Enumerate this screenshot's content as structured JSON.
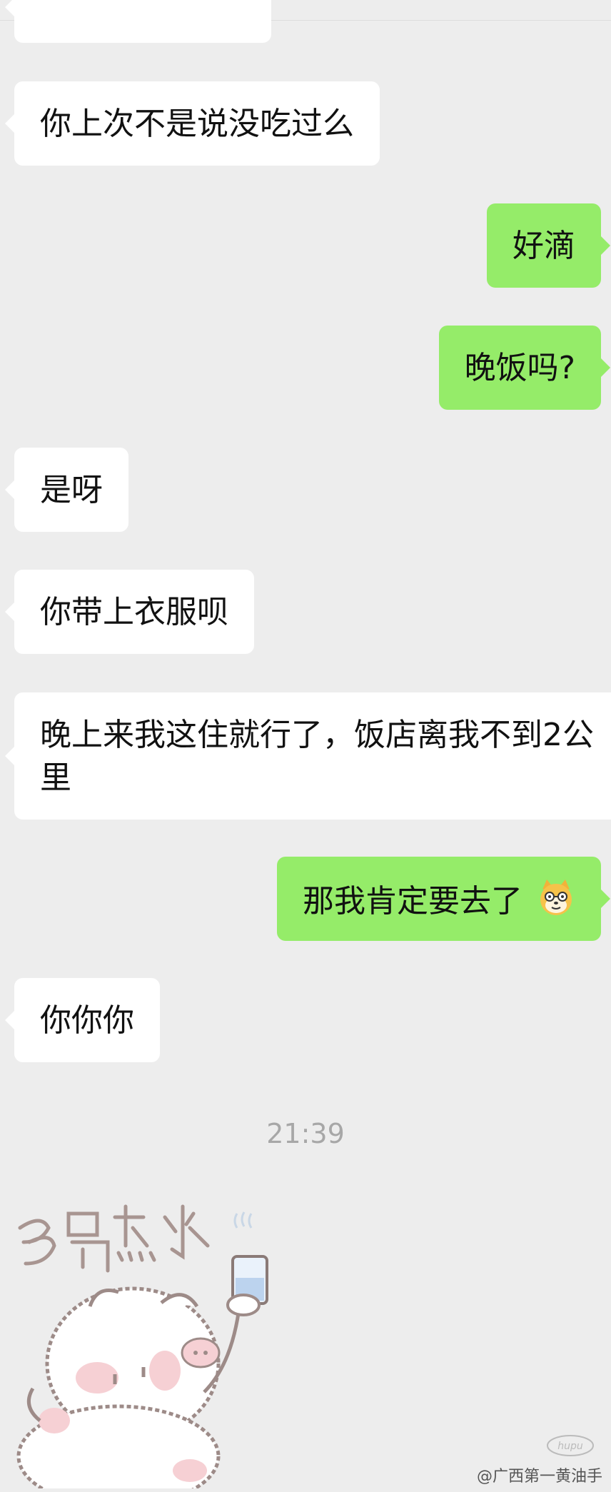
{
  "messages": [
    {
      "side": "recv",
      "text": ""
    },
    {
      "side": "recv",
      "text": "你上次不是说没吃过么"
    },
    {
      "side": "sent",
      "text": "好滴"
    },
    {
      "side": "sent",
      "text": "晚饭吗?"
    },
    {
      "side": "recv",
      "text": "是呀"
    },
    {
      "side": "recv",
      "text": "你带上衣服呗"
    },
    {
      "side": "recv",
      "text": "晚上来我这住就行了，饭店离我不到2公里"
    },
    {
      "side": "sent",
      "text": "那我肯定要去了",
      "emoji": "doge-cat-icon"
    },
    {
      "side": "recv",
      "text": "你你你"
    }
  ],
  "timestamp": "21:39",
  "sticker": {
    "caption": "多喝热水",
    "icon": "pig-drinking-water-sticker"
  },
  "watermark": {
    "text": "@广西第一黄油手",
    "logo": "hupu"
  },
  "colors": {
    "background": "#ededed",
    "received_bubble": "#ffffff",
    "sent_bubble": "#95ec69",
    "timestamp": "#a7a7a7"
  }
}
